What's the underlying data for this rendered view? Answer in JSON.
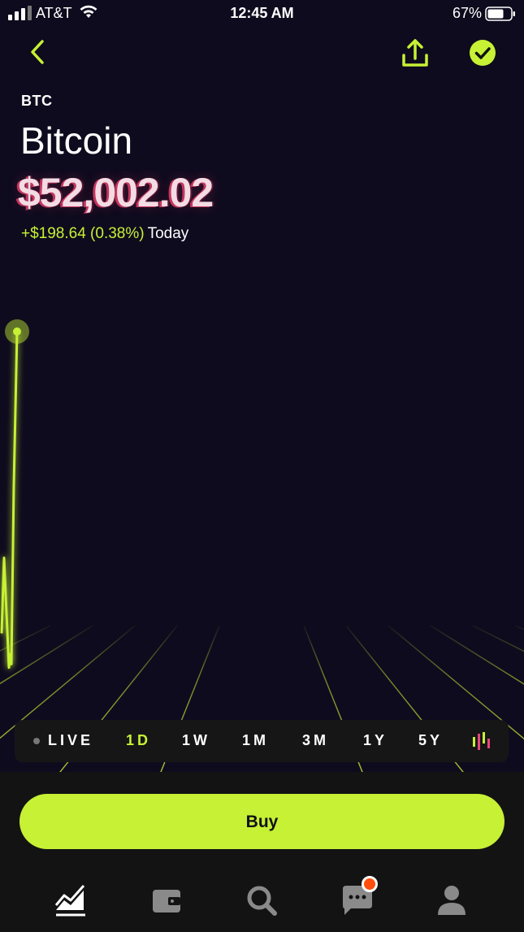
{
  "status_bar": {
    "carrier": "AT&T",
    "time": "12:45 AM",
    "battery_percent": "67%"
  },
  "header": {
    "back_icon": "chevron-left-icon",
    "share_icon": "share-icon",
    "watchlist_icon": "check-circle-icon"
  },
  "asset": {
    "symbol": "BTC",
    "name": "Bitcoin",
    "price": "$52,002.02",
    "change": "+$198.64 (0.38%)",
    "change_period": "Today"
  },
  "chart_data": {
    "type": "line",
    "series": [
      {
        "values": [
          0.12,
          0.34,
          0.02,
          0.06,
          0.03,
          0.55,
          1.0
        ]
      }
    ],
    "grid": true
  },
  "ranges": {
    "options": [
      "LIVE",
      "1D",
      "1W",
      "1M",
      "3M",
      "1Y",
      "5Y"
    ],
    "selected": "1D",
    "chart_type_icon": "candlestick-icon"
  },
  "actions": {
    "buy_label": "Buy"
  },
  "tab_bar": {
    "tabs": [
      "chart-icon",
      "wallet-icon",
      "search-icon",
      "chat-icon",
      "profile-icon"
    ],
    "notification_badge": true
  },
  "colors": {
    "accent": "#c6f135",
    "background": "#0f0b1e",
    "price_glitch": "#c4365e",
    "badge": "#ff4f0f"
  }
}
